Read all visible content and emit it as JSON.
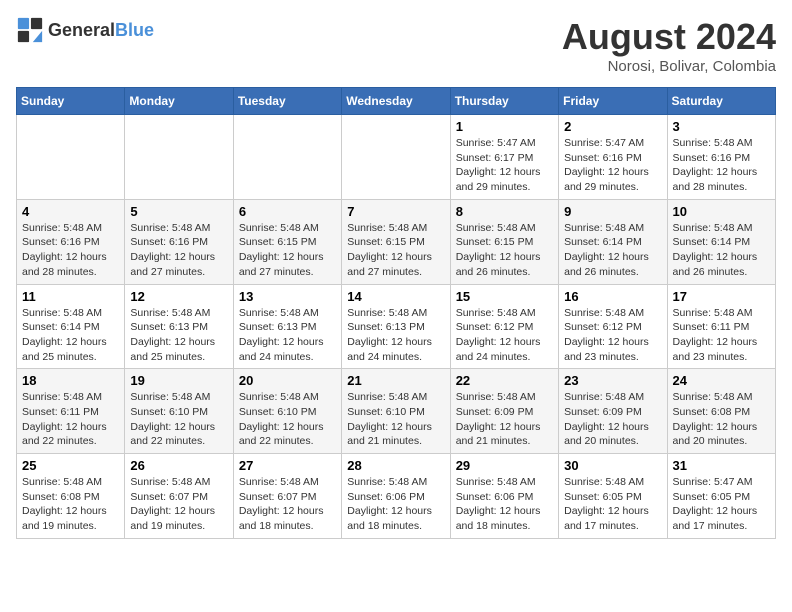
{
  "logo": {
    "text_general": "General",
    "text_blue": "Blue"
  },
  "title": "August 2024",
  "subtitle": "Norosi, Bolivar, Colombia",
  "days_of_week": [
    "Sunday",
    "Monday",
    "Tuesday",
    "Wednesday",
    "Thursday",
    "Friday",
    "Saturday"
  ],
  "weeks": [
    [
      {
        "day": "",
        "detail": ""
      },
      {
        "day": "",
        "detail": ""
      },
      {
        "day": "",
        "detail": ""
      },
      {
        "day": "",
        "detail": ""
      },
      {
        "day": "1",
        "detail": "Sunrise: 5:47 AM\nSunset: 6:17 PM\nDaylight: 12 hours and 29 minutes."
      },
      {
        "day": "2",
        "detail": "Sunrise: 5:47 AM\nSunset: 6:16 PM\nDaylight: 12 hours and 29 minutes."
      },
      {
        "day": "3",
        "detail": "Sunrise: 5:48 AM\nSunset: 6:16 PM\nDaylight: 12 hours and 28 minutes."
      }
    ],
    [
      {
        "day": "4",
        "detail": "Sunrise: 5:48 AM\nSunset: 6:16 PM\nDaylight: 12 hours and 28 minutes."
      },
      {
        "day": "5",
        "detail": "Sunrise: 5:48 AM\nSunset: 6:16 PM\nDaylight: 12 hours and 27 minutes."
      },
      {
        "day": "6",
        "detail": "Sunrise: 5:48 AM\nSunset: 6:15 PM\nDaylight: 12 hours and 27 minutes."
      },
      {
        "day": "7",
        "detail": "Sunrise: 5:48 AM\nSunset: 6:15 PM\nDaylight: 12 hours and 27 minutes."
      },
      {
        "day": "8",
        "detail": "Sunrise: 5:48 AM\nSunset: 6:15 PM\nDaylight: 12 hours and 26 minutes."
      },
      {
        "day": "9",
        "detail": "Sunrise: 5:48 AM\nSunset: 6:14 PM\nDaylight: 12 hours and 26 minutes."
      },
      {
        "day": "10",
        "detail": "Sunrise: 5:48 AM\nSunset: 6:14 PM\nDaylight: 12 hours and 26 minutes."
      }
    ],
    [
      {
        "day": "11",
        "detail": "Sunrise: 5:48 AM\nSunset: 6:14 PM\nDaylight: 12 hours and 25 minutes."
      },
      {
        "day": "12",
        "detail": "Sunrise: 5:48 AM\nSunset: 6:13 PM\nDaylight: 12 hours and 25 minutes."
      },
      {
        "day": "13",
        "detail": "Sunrise: 5:48 AM\nSunset: 6:13 PM\nDaylight: 12 hours and 24 minutes."
      },
      {
        "day": "14",
        "detail": "Sunrise: 5:48 AM\nSunset: 6:13 PM\nDaylight: 12 hours and 24 minutes."
      },
      {
        "day": "15",
        "detail": "Sunrise: 5:48 AM\nSunset: 6:12 PM\nDaylight: 12 hours and 24 minutes."
      },
      {
        "day": "16",
        "detail": "Sunrise: 5:48 AM\nSunset: 6:12 PM\nDaylight: 12 hours and 23 minutes."
      },
      {
        "day": "17",
        "detail": "Sunrise: 5:48 AM\nSunset: 6:11 PM\nDaylight: 12 hours and 23 minutes."
      }
    ],
    [
      {
        "day": "18",
        "detail": "Sunrise: 5:48 AM\nSunset: 6:11 PM\nDaylight: 12 hours and 22 minutes."
      },
      {
        "day": "19",
        "detail": "Sunrise: 5:48 AM\nSunset: 6:10 PM\nDaylight: 12 hours and 22 minutes."
      },
      {
        "day": "20",
        "detail": "Sunrise: 5:48 AM\nSunset: 6:10 PM\nDaylight: 12 hours and 22 minutes."
      },
      {
        "day": "21",
        "detail": "Sunrise: 5:48 AM\nSunset: 6:10 PM\nDaylight: 12 hours and 21 minutes."
      },
      {
        "day": "22",
        "detail": "Sunrise: 5:48 AM\nSunset: 6:09 PM\nDaylight: 12 hours and 21 minutes."
      },
      {
        "day": "23",
        "detail": "Sunrise: 5:48 AM\nSunset: 6:09 PM\nDaylight: 12 hours and 20 minutes."
      },
      {
        "day": "24",
        "detail": "Sunrise: 5:48 AM\nSunset: 6:08 PM\nDaylight: 12 hours and 20 minutes."
      }
    ],
    [
      {
        "day": "25",
        "detail": "Sunrise: 5:48 AM\nSunset: 6:08 PM\nDaylight: 12 hours and 19 minutes."
      },
      {
        "day": "26",
        "detail": "Sunrise: 5:48 AM\nSunset: 6:07 PM\nDaylight: 12 hours and 19 minutes."
      },
      {
        "day": "27",
        "detail": "Sunrise: 5:48 AM\nSunset: 6:07 PM\nDaylight: 12 hours and 18 minutes."
      },
      {
        "day": "28",
        "detail": "Sunrise: 5:48 AM\nSunset: 6:06 PM\nDaylight: 12 hours and 18 minutes."
      },
      {
        "day": "29",
        "detail": "Sunrise: 5:48 AM\nSunset: 6:06 PM\nDaylight: 12 hours and 18 minutes."
      },
      {
        "day": "30",
        "detail": "Sunrise: 5:48 AM\nSunset: 6:05 PM\nDaylight: 12 hours and 17 minutes."
      },
      {
        "day": "31",
        "detail": "Sunrise: 5:47 AM\nSunset: 6:05 PM\nDaylight: 12 hours and 17 minutes."
      }
    ]
  ]
}
